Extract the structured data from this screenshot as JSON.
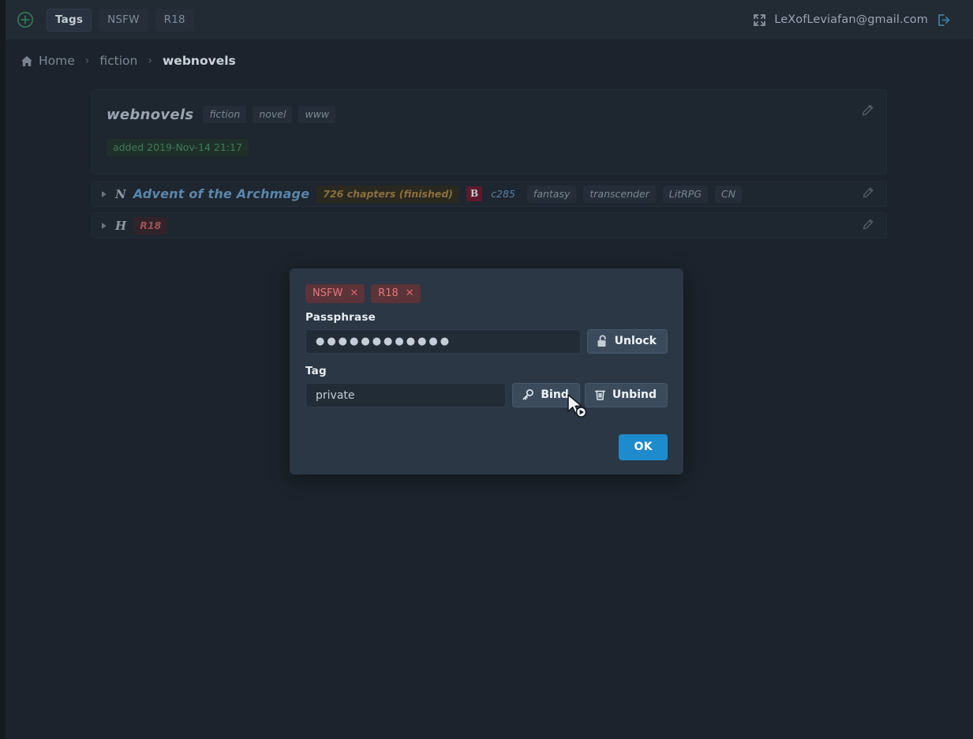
{
  "topbar": {
    "add_icon": "plus-circle-icon",
    "tags": [
      {
        "label": "Tags",
        "state": "active"
      },
      {
        "label": "NSFW",
        "state": "plain"
      },
      {
        "label": "R18",
        "state": "plain"
      }
    ],
    "fullscreen_icon": "expand-icon",
    "user_email": "LeXofLeviafan@gmail.com",
    "logout_icon": "logout-icon"
  },
  "breadcrumb": {
    "home_icon": "home-icon",
    "items": [
      {
        "label": "Home"
      },
      {
        "label": "fiction"
      },
      {
        "label": "webnovels"
      }
    ],
    "separator": "›"
  },
  "card": {
    "title": "webnovels",
    "chips": [
      "fiction",
      "novel",
      "www"
    ],
    "added": "added 2019-Nov-14 21:17",
    "edit_icon": "pencil-icon"
  },
  "rows": [
    {
      "caret_icon": "caret-right-icon",
      "site_letter": "N",
      "title": "Advent of the Archmage",
      "chapters": "726 chapters (finished)",
      "badge": "B",
      "link": "c285",
      "tags": [
        "fantasy",
        "transcender",
        "LitRPG",
        "CN"
      ],
      "edit_icon": "pencil-icon"
    },
    {
      "caret_icon": "caret-right-icon",
      "site_letter": "H",
      "title": "",
      "chapters": "",
      "badge": "",
      "link": "",
      "tags": [
        "R18"
      ],
      "edit_icon": "pencil-icon"
    }
  ],
  "modal": {
    "tags": [
      {
        "label": "NSFW",
        "remove": "✕"
      },
      {
        "label": "R18",
        "remove": "✕"
      }
    ],
    "passphrase_label": "Passphrase",
    "passphrase_value": "●●●●●●●●●●●●",
    "passphrase_placeholder": "",
    "unlock_label": "Unlock",
    "unlock_icon": "unlock-padlock-icon",
    "tag_label": "Tag",
    "tag_value": "private",
    "tag_placeholder": "",
    "bind_label": "Bind",
    "bind_icon": "key-icon",
    "unbind_label": "Unbind",
    "unbind_icon": "trash-icon",
    "ok_label": "OK"
  },
  "colors": {
    "page_bg": "#1c232c",
    "topbar_bg": "#222a34",
    "card_bg": "#1e262f",
    "modal_bg": "#2b3744",
    "accent_ok": "#1e8bcd",
    "link": "#5b86ab",
    "tag_red_bg": "#5b3339",
    "tag_red_text": "#e2787b",
    "added_green": "#3f7a5d"
  },
  "cursor": {
    "icon": "arrow-cursor-click-icon"
  }
}
